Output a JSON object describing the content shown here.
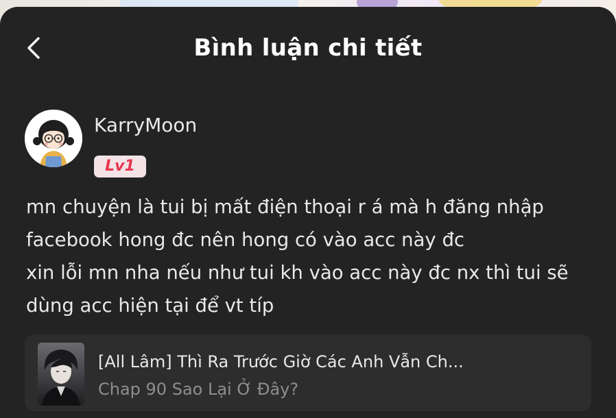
{
  "header": {
    "title": "Bình luận chi tiết",
    "back_icon": "chevron-left-icon"
  },
  "comment": {
    "username": "KarryMoon",
    "level": "Lv1",
    "lines": [
      "mn chuyện là tui bị mất điện thoại r á mà h đăng nhập",
      "facebook hong đc nên hong có vào acc này đc",
      "xin lỗi mn nha nếu như tui kh vào acc này đc nx thì tui sẽ",
      "dùng acc hiện tại để vt típ"
    ]
  },
  "story": {
    "title": "[All Lâm] Thì Ra Trước Giờ Các Anh Vẫn Ch...",
    "chapter": "Chap 90 Sao Lại Ở Đây?"
  },
  "colors": {
    "sheet_bg": "#232324",
    "card_bg": "#2d2d2e",
    "text": "#e9e9e9",
    "muted": "#8e8e90",
    "level_text": "#e8364f",
    "level_bg": "#f3e3e6"
  }
}
